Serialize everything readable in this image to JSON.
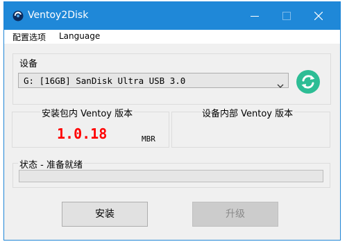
{
  "window": {
    "title": "Ventoy2Disk",
    "accent_color": "#1f88d8",
    "icons": [
      "ventoy-logo-icon",
      "minimize-icon",
      "maximize-icon",
      "close-icon"
    ]
  },
  "menu": {
    "items": [
      {
        "label": "配置选项"
      },
      {
        "label": "Language"
      }
    ]
  },
  "device": {
    "group_label": "设备",
    "selected": "G: [16GB] SanDisk Ultra USB 3.0",
    "refresh_icon": "refresh-icon",
    "refresh_color": "#2dbd95"
  },
  "versions": {
    "local_label": "安装包内 Ventoy 版本",
    "local_version": "1.0.18",
    "local_version_color": "#ff0000",
    "partition_style": "MBR",
    "device_label": "设备内部 Ventoy 版本",
    "device_version": ""
  },
  "status": {
    "label": "状态 - 准备就绪",
    "progress": 0
  },
  "buttons": {
    "install": "安装",
    "update": "升级"
  }
}
